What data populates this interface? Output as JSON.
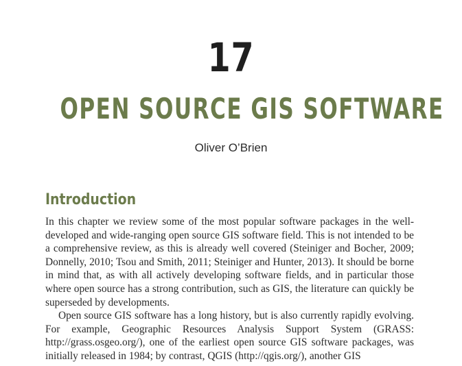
{
  "chapter": {
    "number": "17",
    "title": "OPEN SOURCE GIS SOFTWARE",
    "author": "Oliver O’Brien"
  },
  "section": {
    "heading": "Introduction",
    "paragraphs": [
      "In this chapter we review some of the most popular software packages in the well-developed and wide-ranging open source GIS software field. This is not intended to be a comprehensive review, as this is already well covered (Steiniger and Bocher, 2009; Donnelly, 2010; Tsou and Smith, 2011; Steiniger and Hunter, 2013). It should be borne in mind that, as with all actively developing software fields, and in particular those where open source has a strong contribution, such as GIS, the literature can quickly be superseded by developments.",
      "Open source GIS software has a long history, but is also currently rapidly evolving. For example, Geographic Resources Analysis Support System (GRASS: http://grass.osgeo.org/), one of the earliest open source GIS software packages, was initially released in 1984; by contrast, QGIS (http://qgis.org/), another GIS"
    ]
  }
}
